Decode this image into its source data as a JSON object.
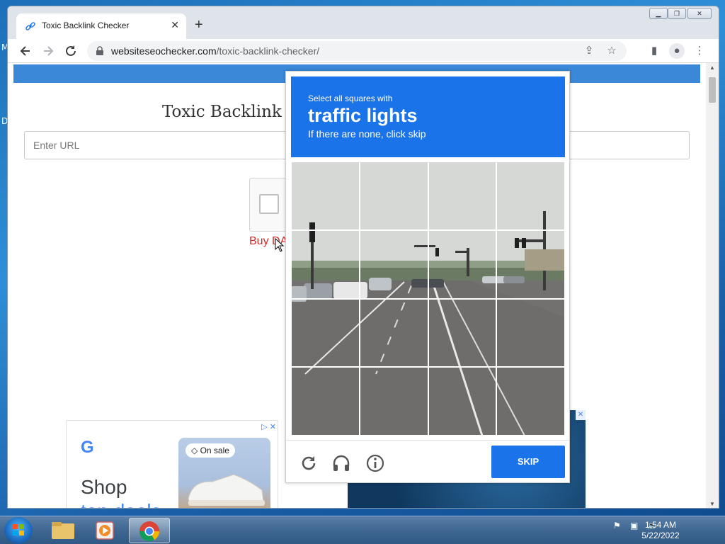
{
  "desktop": {
    "edge_letters": [
      "M",
      "D"
    ]
  },
  "browser": {
    "tab_title": "Toxic Backlink Checker",
    "tab_close": "✕",
    "new_tab": "+",
    "url_host": "websiteseochecker.com",
    "url_path": "/toxic-backlink-checker/"
  },
  "page": {
    "heading": "Toxic Backlink",
    "url_input_placeholder": "Enter URL",
    "buy_link": "Buy DA"
  },
  "ads": {
    "google_logo": "G",
    "shop": "Shop",
    "top_deals": "top deals",
    "on_sale": "On sale"
  },
  "captcha": {
    "instruction_small": "Select all squares with",
    "target": "traffic lights",
    "instruction_sub": "If there are none, click skip",
    "skip_label": "SKIP",
    "grid_rows": 4,
    "grid_cols": 4
  },
  "taskbar": {
    "time": "1:54 AM",
    "date": "5/22/2022"
  },
  "colors": {
    "captcha_blue": "#1a73e8",
    "page_banner": "#3b88d8",
    "buy_link": "#d12a2a"
  }
}
